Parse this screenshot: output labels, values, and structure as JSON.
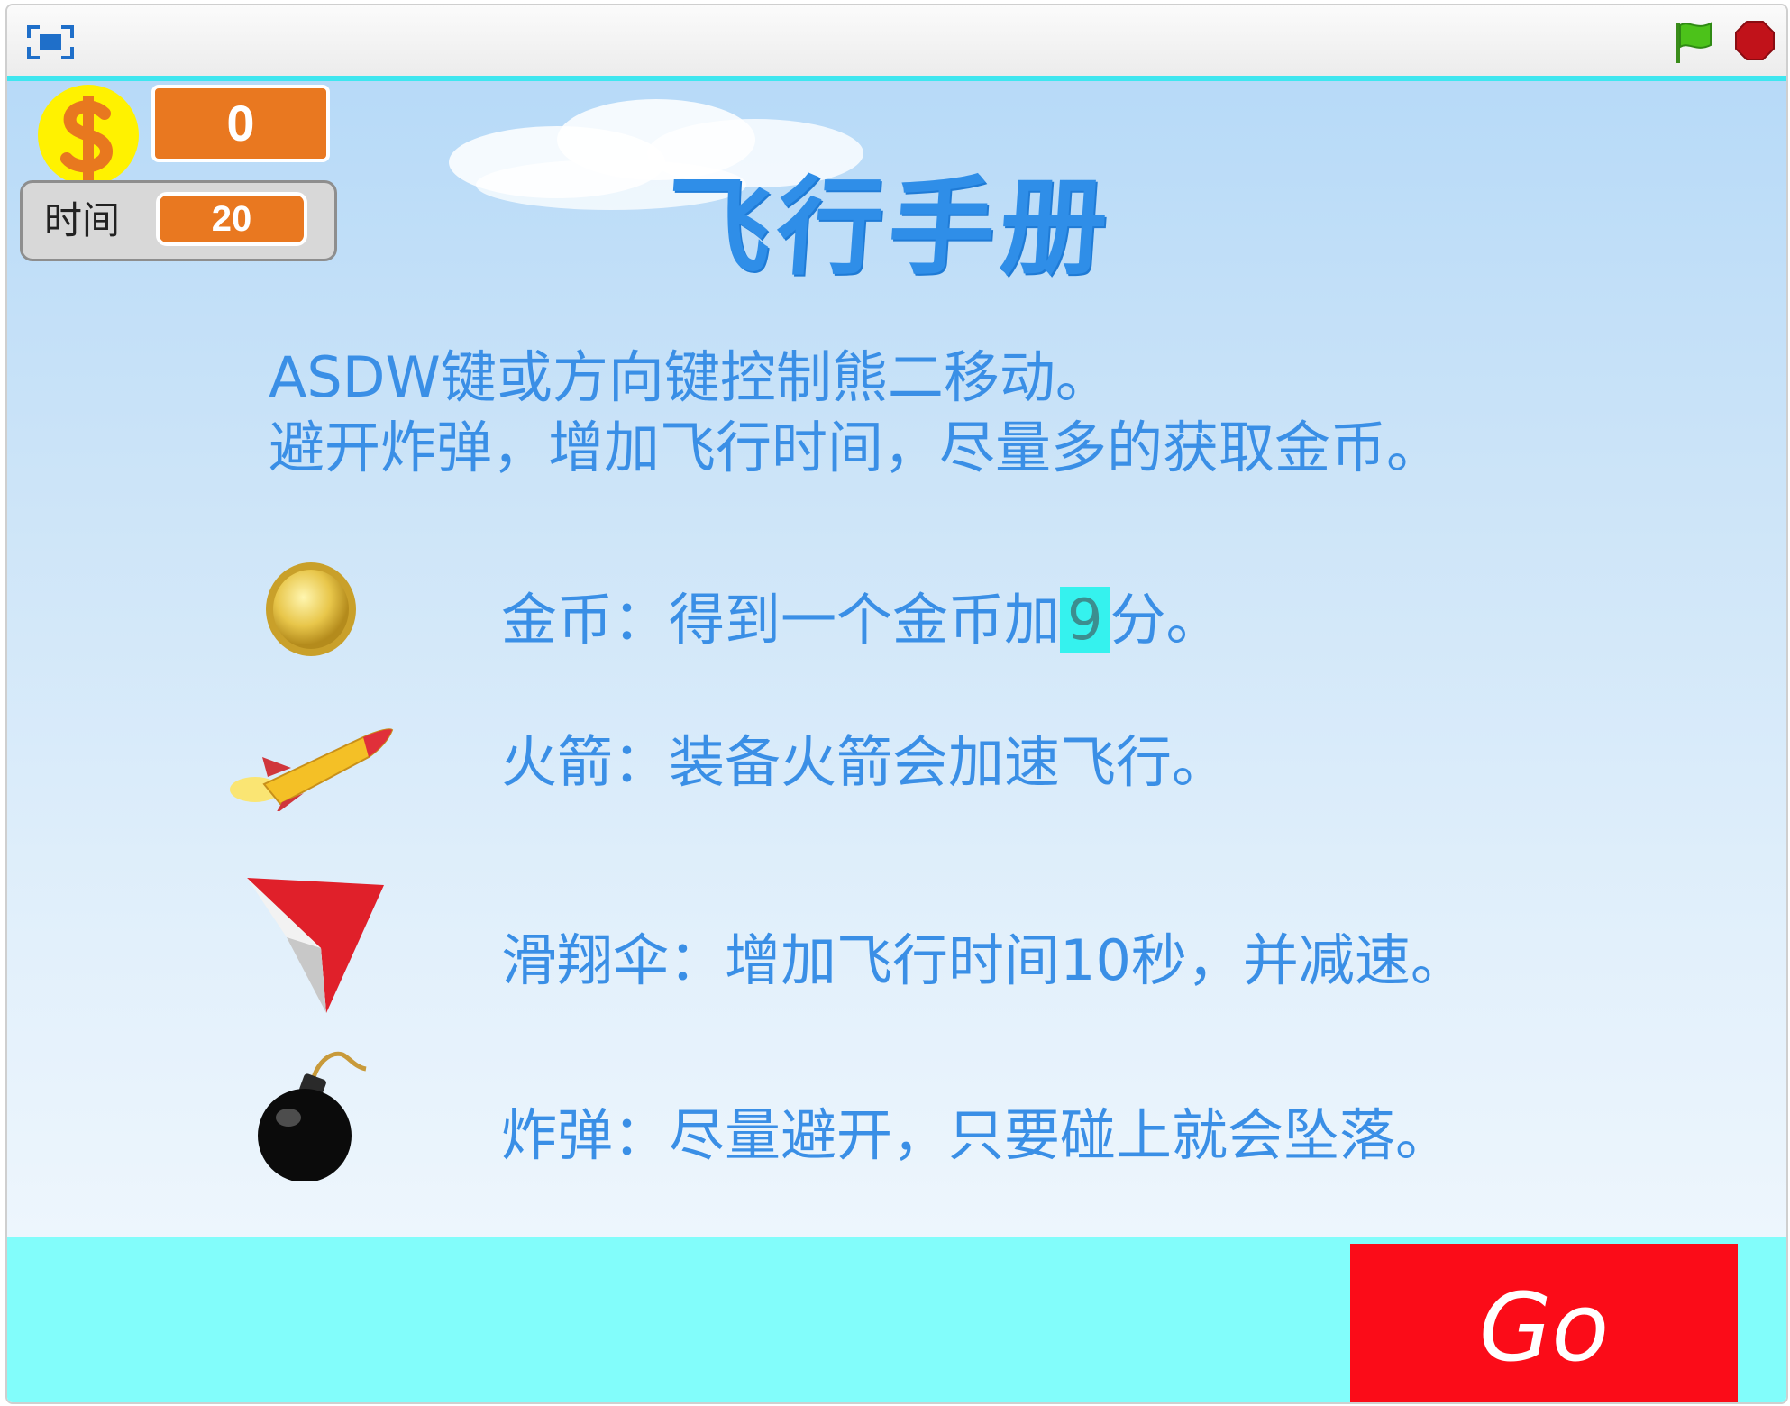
{
  "toolbar": {
    "fullscreen_icon": "fullscreen-icon",
    "flag_icon": "green-flag-icon",
    "stop_icon": "stop-icon"
  },
  "hud": {
    "score": "0",
    "time_label": "时间",
    "time_value": "20"
  },
  "title": "飞行手册",
  "intro": {
    "line1": "ASDW键或方向键控制熊二移动。",
    "line2": "避开炸弹，增加飞行时间，尽量多的获取金币。"
  },
  "items": {
    "coin": {
      "prefix": "金币：得到一个金币加",
      "value": "9",
      "suffix": "分。"
    },
    "rocket": {
      "text": "火箭：装备火箭会加速飞行。"
    },
    "glider": {
      "text": "滑翔伞：增加飞行时间10秒，并减速。"
    },
    "bomb": {
      "text": "炸弹：尽量避开，只要碰上就会坠落。"
    }
  },
  "go_button": {
    "label": "Go"
  },
  "colors": {
    "title": "#2f8ee8",
    "text": "#3a8fe6",
    "monitor_orange": "#e97820",
    "go_red": "#fb0c18",
    "bottom_cyan": "#82fdfb"
  }
}
